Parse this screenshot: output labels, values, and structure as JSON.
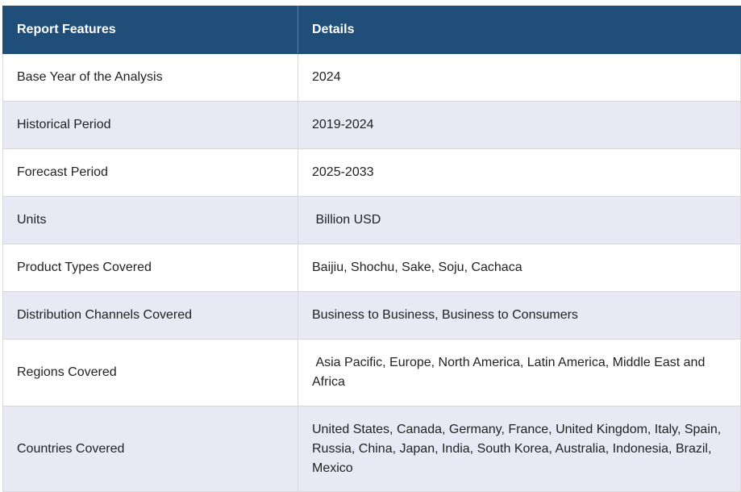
{
  "table": {
    "headers": [
      "Report Features",
      "Details"
    ],
    "rows": [
      {
        "feature": "Base Year of the Analysis",
        "details": "2024"
      },
      {
        "feature": "Historical Period",
        "details": "2019-2024"
      },
      {
        "feature": "Forecast Period",
        "details": "2025-2033"
      },
      {
        "feature": "Units",
        "details": " Billion USD"
      },
      {
        "feature": "Product Types Covered",
        "details": "Baijiu, Shochu, Sake, Soju, Cachaca"
      },
      {
        "feature": "Distribution Channels Covered",
        "details": "Business to Business, Business to Consumers"
      },
      {
        "feature": "Regions Covered",
        "details": " Asia Pacific, Europe, North America, Latin America, Middle East and Africa"
      },
      {
        "feature": "Countries Covered",
        "details": "United States, Canada, Germany, France, United Kingdom, Italy, Spain, Russia, China, Japan, India, South Korea, Australia, Indonesia, Brazil, Mexico"
      }
    ]
  },
  "colors": {
    "header_bg": "#1f4e79",
    "header_text": "#ffffff",
    "alt_row_bg": "#e8e9f5",
    "border": "#d8d8d8"
  }
}
